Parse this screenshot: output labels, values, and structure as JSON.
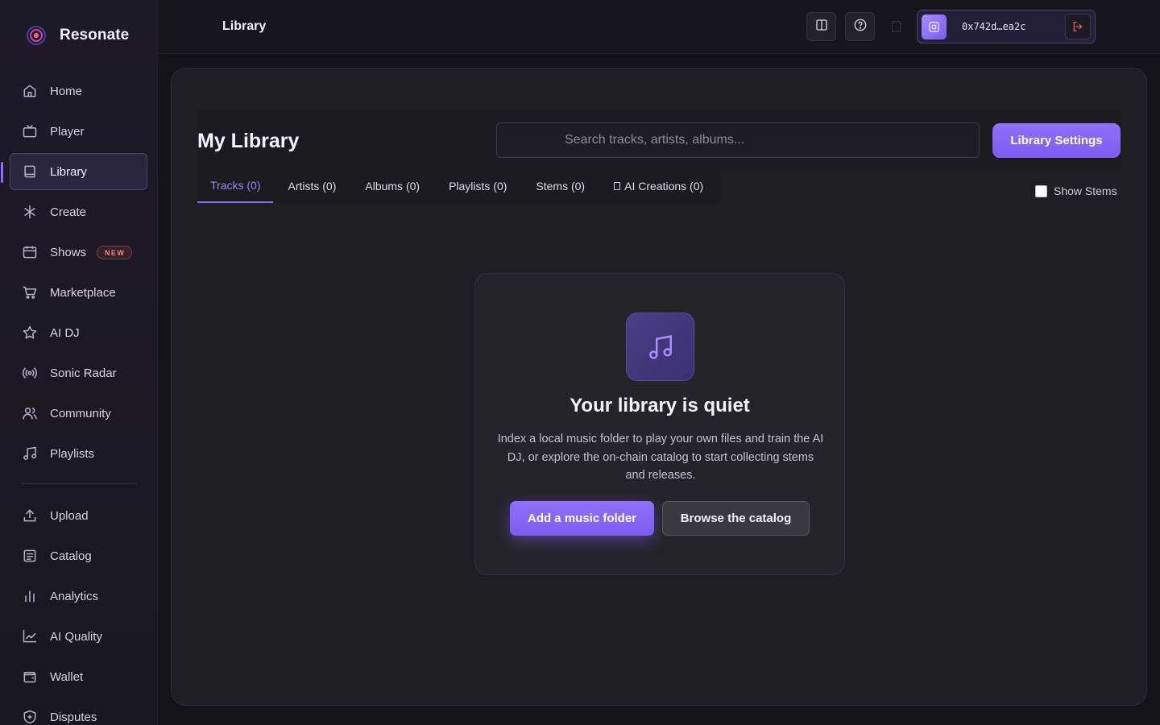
{
  "brand": {
    "name": "Resonate"
  },
  "sidebar": {
    "items": [
      {
        "label": "Home",
        "icon": "home-icon"
      },
      {
        "label": "Player",
        "icon": "tv-icon"
      },
      {
        "label": "Library",
        "icon": "book-icon",
        "active": true
      },
      {
        "label": "Create",
        "icon": "sparkle-icon"
      },
      {
        "label": "Shows",
        "icon": "calendar-icon",
        "badge": "NEW"
      },
      {
        "label": "Marketplace",
        "icon": "cart-icon"
      },
      {
        "label": "AI DJ",
        "icon": "star-icon"
      },
      {
        "label": "Sonic Radar",
        "icon": "radio-icon"
      },
      {
        "label": "Community",
        "icon": "users-icon"
      },
      {
        "label": "Playlists",
        "icon": "music-icon"
      }
    ],
    "secondary": [
      {
        "label": "Upload",
        "icon": "upload-icon"
      },
      {
        "label": "Catalog",
        "icon": "catalog-icon"
      },
      {
        "label": "Analytics",
        "icon": "bar-chart-icon"
      },
      {
        "label": "AI Quality",
        "icon": "line-chart-icon"
      },
      {
        "label": "Wallet",
        "icon": "wallet-icon"
      },
      {
        "label": "Disputes",
        "icon": "shield-icon"
      }
    ]
  },
  "header": {
    "title": "Library",
    "wallet_address": "0x742d…ea2c"
  },
  "library": {
    "title": "My Library",
    "search_placeholder": "Search tracks, artists, albums...",
    "settings_label": "Library Settings",
    "tabs": [
      {
        "label": "Tracks (0)",
        "active": true
      },
      {
        "label": "Artists (0)"
      },
      {
        "label": "Albums (0)"
      },
      {
        "label": "Playlists (0)"
      },
      {
        "label": "Stems (0)"
      },
      {
        "label": "AI Creations (0)"
      }
    ],
    "show_stems_label": "Show Stems",
    "show_stems_checked": false
  },
  "empty_state": {
    "title": "Your library is quiet",
    "description": "Index a local music folder to play your own files and train the AI DJ, or explore the on-chain catalog to start collecting stems and releases.",
    "primary_label": "Add a music folder",
    "secondary_label": "Browse the catalog"
  },
  "colors": {
    "accent": "#8b6cf6",
    "background": "#141318",
    "panel": "#1f1e23",
    "logout": "#ea5a6a"
  }
}
